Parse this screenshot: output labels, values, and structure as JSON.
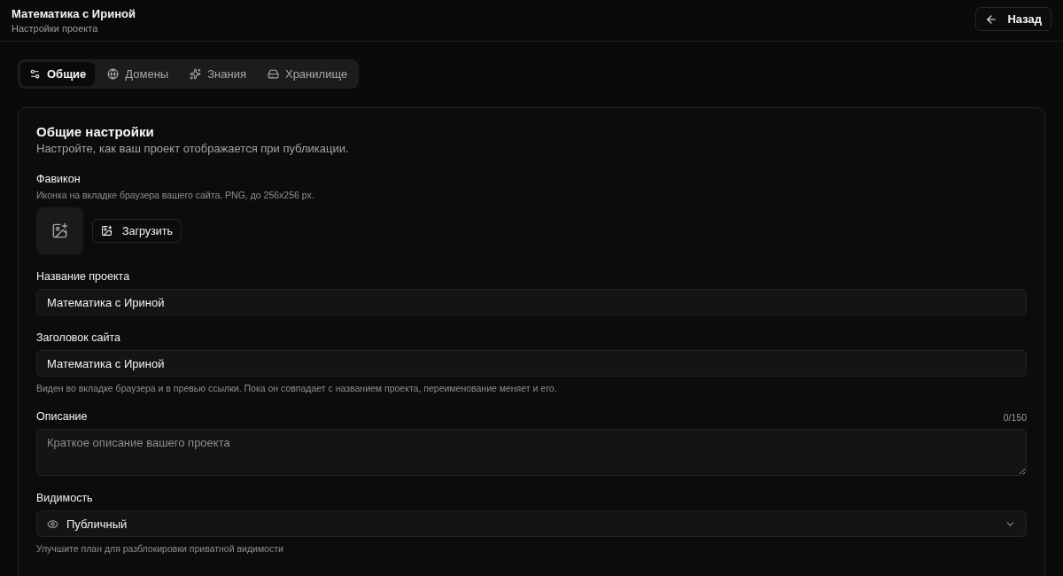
{
  "header": {
    "title": "Математика с Ириной",
    "subtitle": "Настройки проекта",
    "back_button": "Назад"
  },
  "tabs": [
    {
      "label": "Общие",
      "selected": true
    },
    {
      "label": "Домены",
      "selected": false
    },
    {
      "label": "Знания",
      "selected": false
    },
    {
      "label": "Хранилище",
      "selected": false
    }
  ],
  "section": {
    "title": "Общие настройки",
    "description": "Настройте, как ваш проект отображается при публикации."
  },
  "favicon": {
    "label": "Фавикон",
    "hint": "Иконка на вкладке браузера вашего сайта. PNG, до 256x256 px.",
    "upload_button": "Загрузить"
  },
  "fields": [
    {
      "kind": "input",
      "label": "Название проекта",
      "value": "Математика с Ириной"
    },
    {
      "kind": "input",
      "label": "Заголовок сайта",
      "value": "Математика с Ириной",
      "hint": "Виден во вкладке браузера и в превью ссылки. Пока он совпадает с названием проекта, переименование меняет и его."
    },
    {
      "kind": "textarea",
      "label": "Описание",
      "counter": "0/150",
      "placeholder": "Краткое описание вашего проекта"
    },
    {
      "kind": "select",
      "label": "Видимость",
      "value": "Публичный",
      "hint": "Улучшите план для разблокировки приватной видимости"
    }
  ]
}
